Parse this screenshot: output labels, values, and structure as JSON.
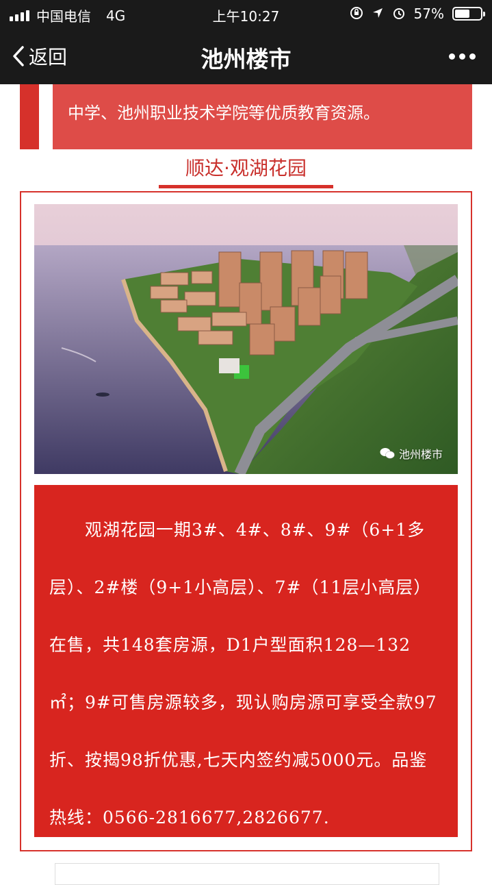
{
  "status_bar": {
    "carrier": "中国电信",
    "network": "4G",
    "time": "上午10:27",
    "battery": "57%",
    "battery_level": 0.57
  },
  "nav": {
    "back_label": "返回",
    "title": "池州楼市"
  },
  "intro": {
    "text": "中学、池州职业技术学院等优质教育资源。"
  },
  "project": {
    "title": "顺达·观湖花园",
    "watermark": "池州楼市",
    "description": "观湖花园一期3#、4#、8#、9#（6+1多层）、2#楼（9+1小高层）、7#（11层小高层）在售，共148套房源，D1户型面积128—132㎡；9#可售房源较多，现认购房源可享受全款97折、按揭98折优惠,七天内签约减5000元。品鉴热线：0566-2816677,2826677."
  },
  "colors": {
    "accent": "#d6312b",
    "bar_bg": "#1a1a1a"
  }
}
